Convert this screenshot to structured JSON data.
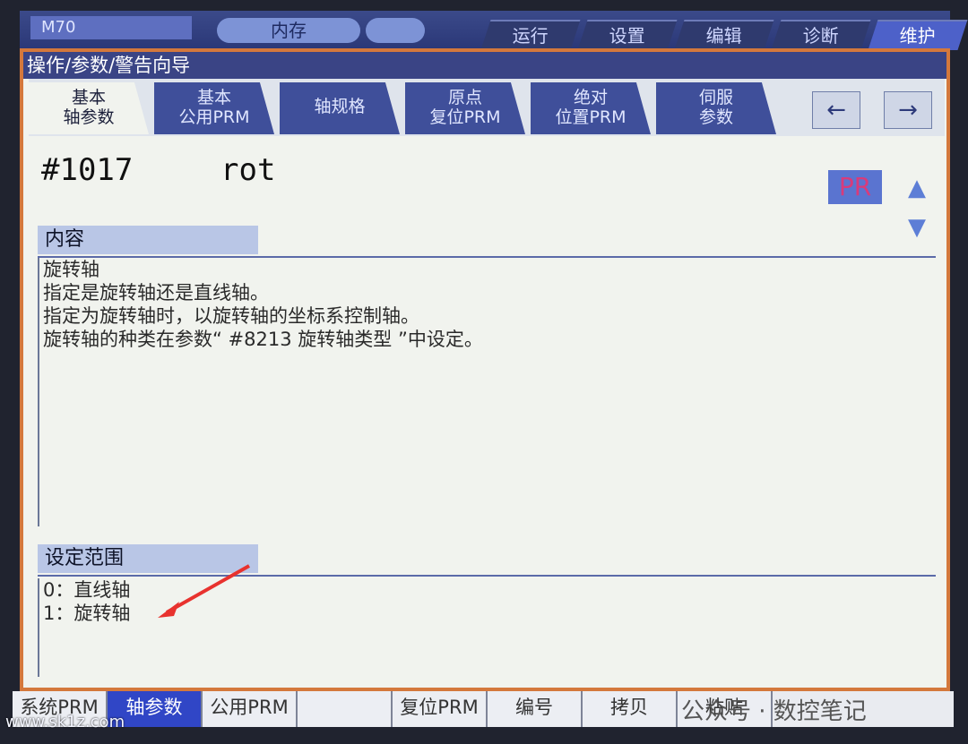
{
  "topbar": {
    "model": "M70",
    "memory_label": "内存",
    "mode_tabs": [
      {
        "label": "运行",
        "active": false
      },
      {
        "label": "设置",
        "active": false
      },
      {
        "label": "编辑",
        "active": false
      },
      {
        "label": "诊断",
        "active": false
      },
      {
        "label": "维护",
        "active": true
      }
    ]
  },
  "breadcrumb": "操作/参数/警告向导",
  "param_tabs": [
    {
      "line1": "基本",
      "line2": "轴参数",
      "active": true
    },
    {
      "line1": "基本",
      "line2": "公用PRM",
      "active": false
    },
    {
      "line1": "轴规格",
      "line2": "",
      "active": false
    },
    {
      "line1": "原点",
      "line2": "复位PRM",
      "active": false
    },
    {
      "line1": "绝对",
      "line2": "位置PRM",
      "active": false
    },
    {
      "line1": "伺服",
      "line2": "参数",
      "active": false
    }
  ],
  "nav_icons": {
    "prev": "arrow-left-icon",
    "next": "arrow-right-icon"
  },
  "param": {
    "number": "#1017",
    "name": "rot",
    "badge": "PR"
  },
  "content": {
    "header": "内容",
    "lines": [
      "旋转轴",
      "指定是旋转轴还是直线轴。",
      "指定为旋转轴时，以旋转轴的坐标系控制轴。",
      "旋转轴的种类在参数“ #8213 旋转轴类型 ”中设定。"
    ]
  },
  "range": {
    "header": "设定范围",
    "lines": [
      "0：直线轴",
      "1：旋转轴"
    ]
  },
  "softkeys": [
    {
      "label": "系统PRM",
      "active": false
    },
    {
      "label": "轴参数",
      "active": true
    },
    {
      "label": "公用PRM",
      "active": false
    },
    {
      "label": "",
      "active": false
    },
    {
      "label": "复位PRM",
      "active": false
    },
    {
      "label": "编号",
      "active": false
    },
    {
      "label": "拷贝",
      "active": false
    },
    {
      "label": "粘贴",
      "active": false
    }
  ],
  "watermark": {
    "site": "www.sk1z.com",
    "account": "公众号 · 数控笔记"
  },
  "colors": {
    "frame": "#d4783c",
    "active_key": "#3046c6",
    "arrow_annotation": "#e8322e"
  }
}
